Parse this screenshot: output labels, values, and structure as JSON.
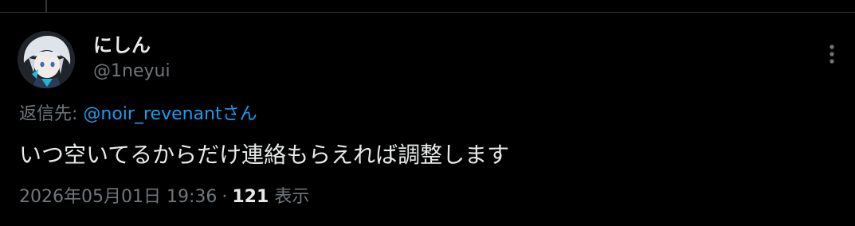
{
  "tweet": {
    "display_name": "にしん",
    "handle": "@1neyui",
    "reply_prefix": "返信先: ",
    "reply_mention": "@noir_revenant",
    "reply_suffix": "さん",
    "text": "いつ空いてるからだけ連絡もらえれば調整します",
    "timestamp": "2026年05月01日 19:36",
    "separator": "·",
    "views_count": "121",
    "views_label": "表示"
  },
  "icons": {
    "more": "more-horizontal-icon",
    "avatar": "anime-character-avatar"
  },
  "colors": {
    "background": "#000000",
    "text_primary": "#e7e9ea",
    "text_secondary": "#71767b",
    "accent": "#1d9bf0",
    "divider": "#2f3336"
  }
}
